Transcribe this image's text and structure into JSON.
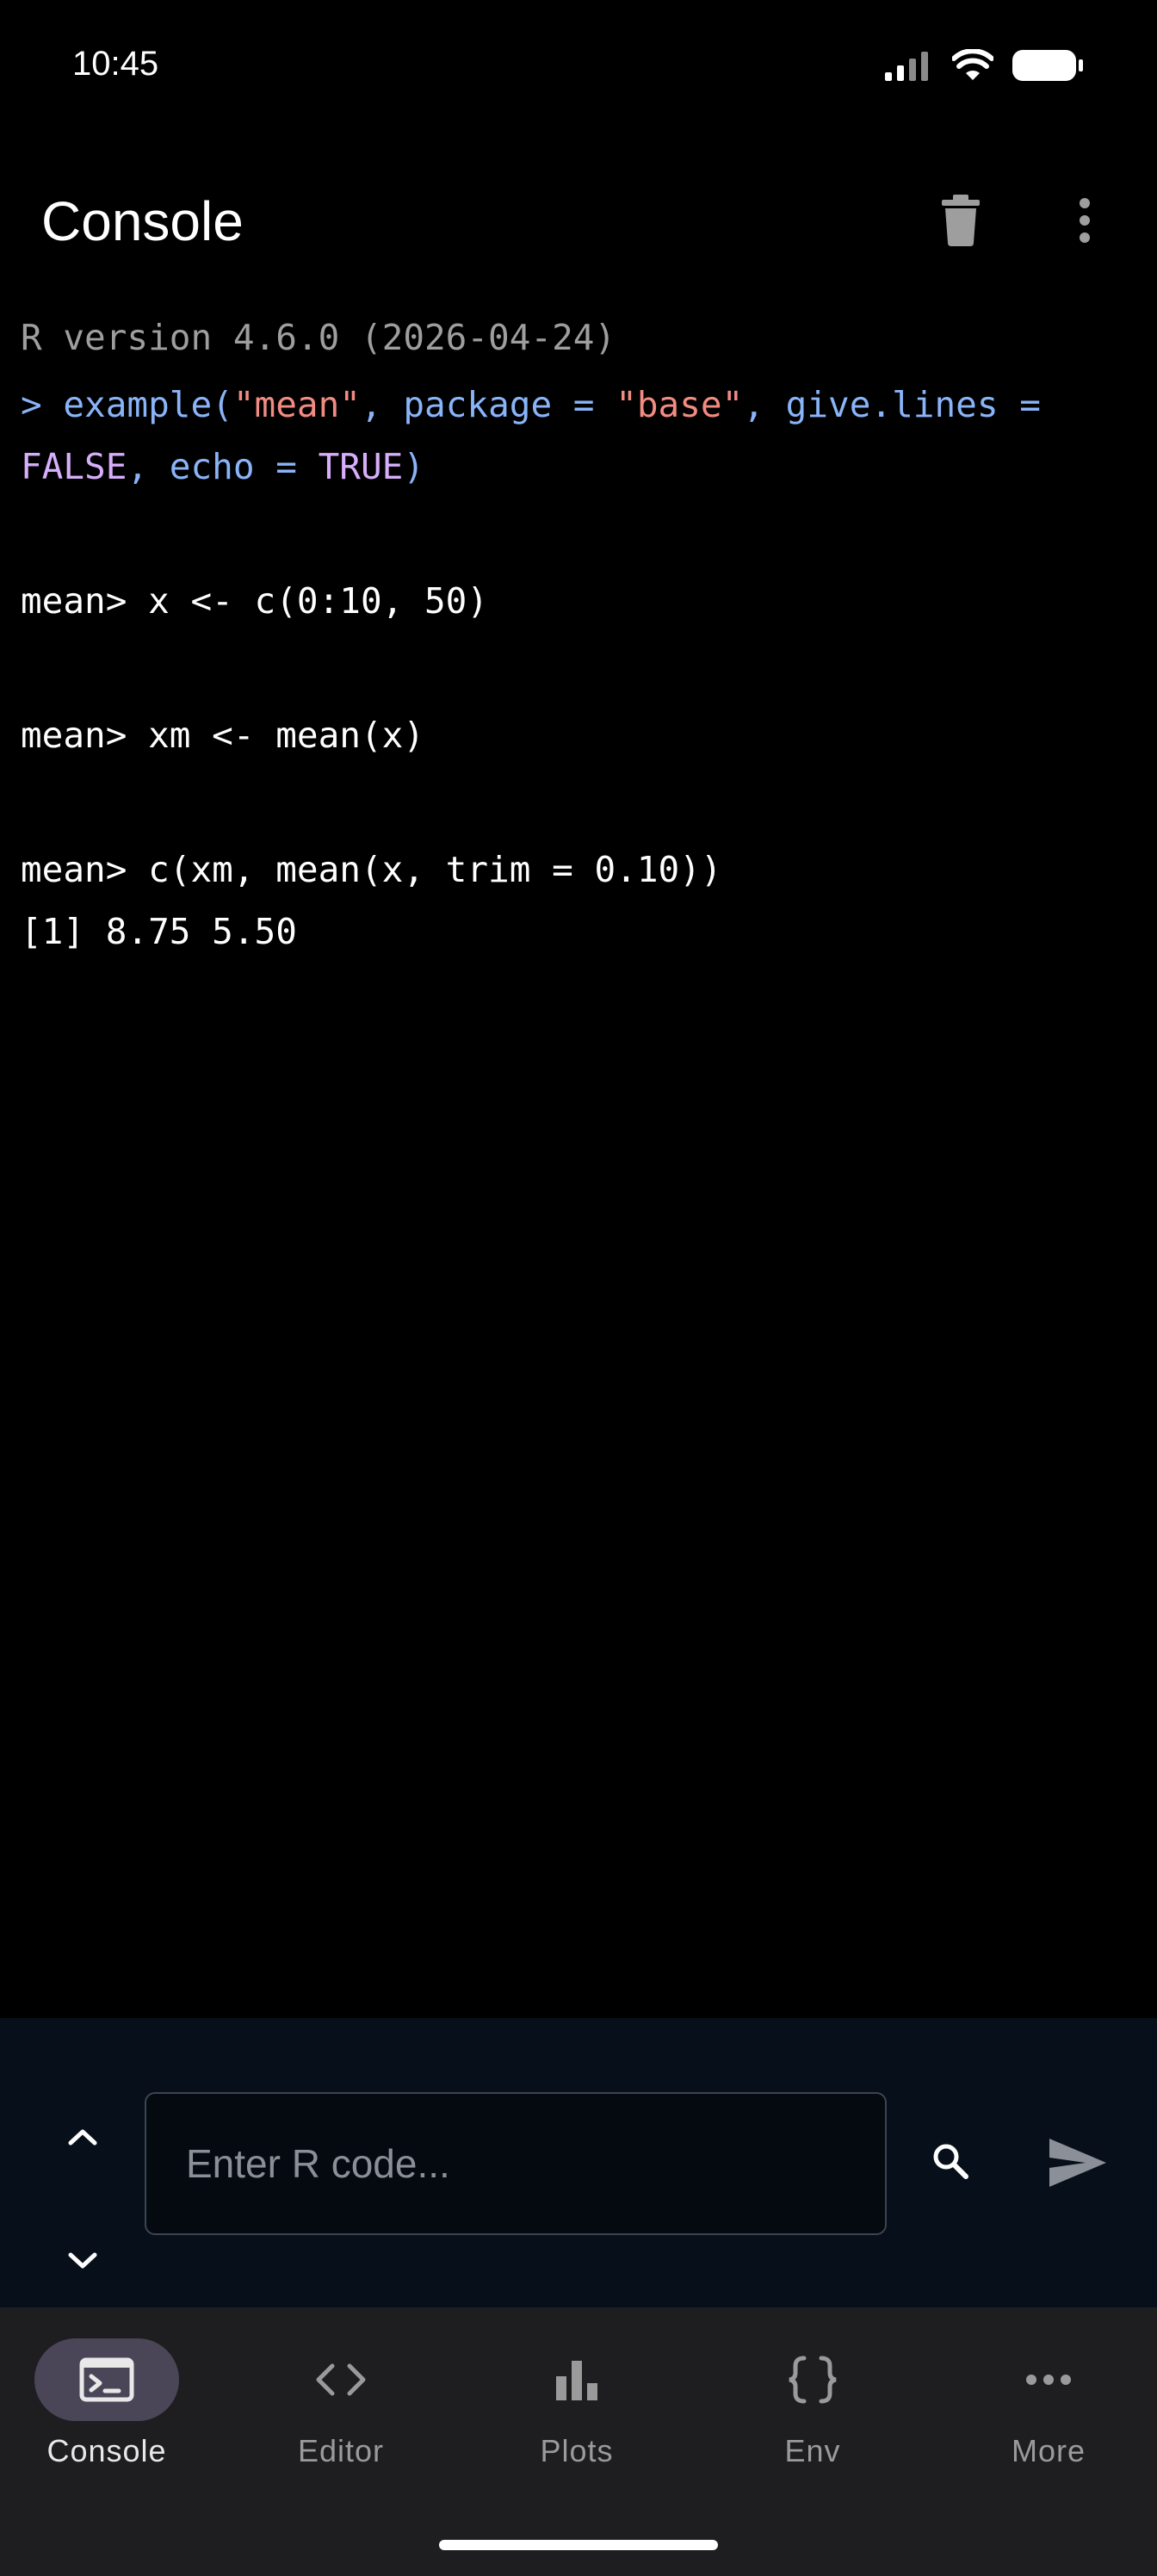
{
  "status": {
    "time": "10:45"
  },
  "app_bar": {
    "title": "Console",
    "actions": [
      "delete-icon",
      "more-vert-icon"
    ]
  },
  "console": {
    "version_line": "R version 4.6.0 (2026-04-24)",
    "command": {
      "prompt": "> ",
      "fn_open": "example(",
      "arg1": "\"mean\"",
      "sep1": ", package = ",
      "arg2": "\"base\"",
      "sep2": ", give.lines =",
      "false_kw": "FALSE",
      "sep3": ", echo = ",
      "true_kw": "TRUE",
      "close": ")"
    },
    "lines": [
      "mean> x <- c(0:10, 50)",
      "mean> xm <- mean(x)",
      "mean> c(xm, mean(x, trim = 0.10))",
      "[1] 8.75 5.50"
    ]
  },
  "input": {
    "placeholder": "Enter R code...",
    "value": ""
  },
  "nav": {
    "items": [
      {
        "label": "Console",
        "icon": "terminal-icon",
        "active": true
      },
      {
        "label": "Editor",
        "icon": "code-icon",
        "active": false
      },
      {
        "label": "Plots",
        "icon": "bar-chart-icon",
        "active": false
      },
      {
        "label": "Env",
        "icon": "braces-icon",
        "active": false
      },
      {
        "label": "More",
        "icon": "more-horiz-icon",
        "active": false
      }
    ]
  },
  "colors": {
    "background": "#000000",
    "prompt_blue": "#8ab4f8",
    "string_red": "#f28b82",
    "keyword_purple": "#d7aefb",
    "nav_active": "#4a4658"
  }
}
